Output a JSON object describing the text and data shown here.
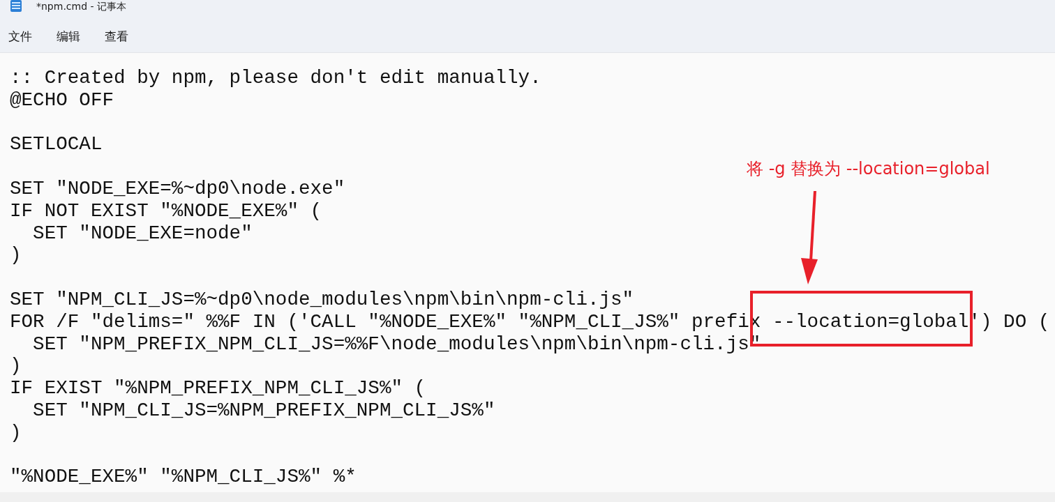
{
  "window": {
    "title": "*npm.cmd - 记事本"
  },
  "menu": [
    {
      "label": "文件"
    },
    {
      "label": "编辑"
    },
    {
      "label": "查看"
    }
  ],
  "editor": {
    "lines": [
      {
        "kind": "code",
        "text": ":: Created by npm, please don't edit manually."
      },
      {
        "kind": "code",
        "text": "@ECHO OFF"
      },
      {
        "kind": "blank"
      },
      {
        "kind": "code",
        "text": "SETLOCAL"
      },
      {
        "kind": "blank"
      },
      {
        "kind": "code",
        "text": "SET \"NODE_EXE=%~dp0\\node.exe\""
      },
      {
        "kind": "code",
        "text": "IF NOT EXIST \"%NODE_EXE%\" ("
      },
      {
        "kind": "code",
        "text": "  SET \"NODE_EXE=node\""
      },
      {
        "kind": "code",
        "text": ")"
      },
      {
        "kind": "blank"
      },
      {
        "kind": "code",
        "text": "SET \"NPM_CLI_JS=%~dp0\\node_modules\\npm\\bin\\npm-cli.js\""
      },
      {
        "kind": "code",
        "text": "FOR /F \"delims=\" %%F IN ('CALL \"%NODE_EXE%\" \"%NPM_CLI_JS%\" prefix --location=global') DO ("
      },
      {
        "kind": "code",
        "text": "  SET \"NPM_PREFIX_NPM_CLI_JS=%%F\\node_modules\\npm\\bin\\npm-cli.js\""
      },
      {
        "kind": "code",
        "text": ")"
      },
      {
        "kind": "code",
        "text": "IF EXIST \"%NPM_PREFIX_NPM_CLI_JS%\" ("
      },
      {
        "kind": "code",
        "text": "  SET \"NPM_CLI_JS=%NPM_PREFIX_NPM_CLI_JS%\""
      },
      {
        "kind": "code",
        "text": ")"
      },
      {
        "kind": "blank"
      },
      {
        "kind": "code",
        "text": "\"%NODE_EXE%\" \"%NPM_CLI_JS%\" %*"
      }
    ]
  },
  "annotation": {
    "text": "将 -g 替换为 --location=global",
    "color": "#e8202a"
  }
}
